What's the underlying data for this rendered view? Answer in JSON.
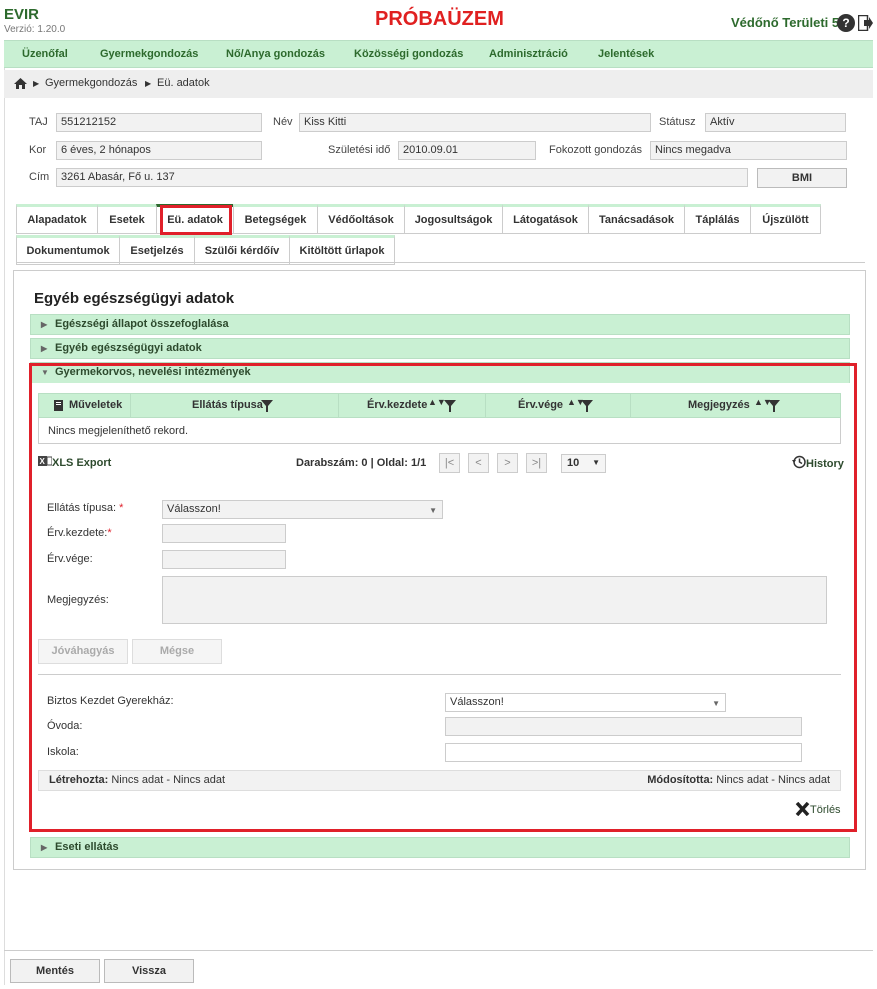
{
  "header": {
    "app_name": "EVIR",
    "version": "Verzió: 1.20.0",
    "environment": "PRÓBAÜZEM",
    "user": "Védőnő Területi 5",
    "help_glyph": "?"
  },
  "menu": [
    "Üzenőfal",
    "Gyermekgondozás",
    "Nő/Anya gondozás",
    "Közösségi gondozás",
    "Adminisztráció",
    "Jelentések"
  ],
  "breadcrumb": [
    "Gyermekgondozás",
    "Eü. adatok"
  ],
  "patient": {
    "taj_label": "TAJ",
    "taj": "551212152",
    "nev_label": "Név",
    "nev": "Kiss Kitti",
    "status_label": "Státusz",
    "status": "Aktív",
    "kor_label": "Kor",
    "kor": "6 éves, 2 hónapos",
    "szul_label": "Születési idő",
    "szul": "2010.09.01",
    "fokozott_label": "Fokozott gondozás",
    "fokozott": "Nincs megadva",
    "cim_label": "Cím",
    "cim": "3261 Abasár, Fő u. 137",
    "bmi_button": "BMI"
  },
  "tabs_row1": [
    "Alapadatok",
    "Esetek",
    "Eü. adatok",
    "Betegségek",
    "Védőoltások",
    "Jogosultságok",
    "Látogatások",
    "Tanácsadások",
    "Táplálás",
    "Újszülött"
  ],
  "tabs_row2": [
    "Dokumentumok",
    "Esetjelzés",
    "Szülői kérdőív",
    "Kitöltött űrlapok"
  ],
  "section_title": "Egyéb egészségügyi adatok",
  "accordions": {
    "a1": "Egészségi állapot összefoglalása",
    "a2": "Egyéb egészségügyi adatok",
    "a3": "Gyermekorvos, nevelési intézmények",
    "a4": "Eseti ellátás"
  },
  "grid": {
    "columns": [
      "Műveletek",
      "Ellátás típusa",
      "Érv.kezdete",
      "Érv.vége",
      "Megjegyzés"
    ],
    "empty": "Nincs megjeleníthető rekord."
  },
  "pager": {
    "xls_export": "XLS Export",
    "info": "Darabszám: 0 | Oldal: 1/1",
    "page_size": "10",
    "history": "History"
  },
  "form": {
    "ellatas_label": "Ellátás típusa:",
    "ellatas_value": "Válasszon!",
    "kezdete_label": "Érv.kezdete:",
    "vege_label": "Érv.vége:",
    "megjegyzes_label": "Megjegyzés:",
    "approve": "Jóváhagyás",
    "cancel": "Mégse",
    "biztos_label": "Biztos Kezdet Gyerekház:",
    "biztos_value": "Válasszon!",
    "ovoda_label": "Óvoda:",
    "iskola_label": "Iskola:",
    "required_mark": "*"
  },
  "meta": {
    "created_label": "Létrehozta:",
    "created_value": "Nincs adat - Nincs adat",
    "modified_label": "Módosította:",
    "modified_value": "Nincs adat - Nincs adat",
    "delete": "Törlés"
  },
  "footer": {
    "save": "Mentés",
    "back": "Vissza"
  },
  "colors": {
    "brand_green": "#2d6a2d",
    "menu_bg": "#c9f0d3",
    "highlight_red": "#e0202a"
  }
}
